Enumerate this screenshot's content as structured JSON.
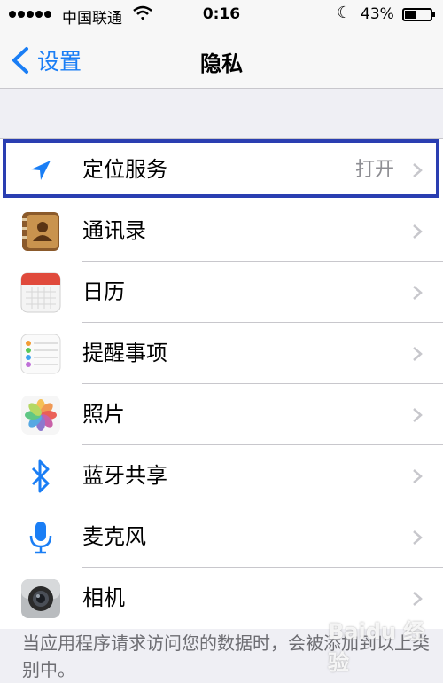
{
  "status_bar": {
    "carrier": "中国联通",
    "time": "0:16",
    "battery_percent": "43%",
    "battery_level": 0.43
  },
  "nav": {
    "back_label": "设置",
    "title": "隐私"
  },
  "rows": [
    {
      "label": "定位服务",
      "value": "打开",
      "icon": "location-arrow-icon"
    },
    {
      "label": "通讯录",
      "icon": "contacts-icon"
    },
    {
      "label": "日历",
      "icon": "calendar-icon"
    },
    {
      "label": "提醒事项",
      "icon": "reminders-icon"
    },
    {
      "label": "照片",
      "icon": "photos-icon"
    },
    {
      "label": "蓝牙共享",
      "icon": "bluetooth-icon"
    },
    {
      "label": "麦克风",
      "icon": "microphone-icon"
    },
    {
      "label": "相机",
      "icon": "camera-icon"
    }
  ],
  "footer_text": "当应用程序请求访问您的数据时，会被添加到以上类别中。",
  "watermark": "Baidu 经验",
  "colors": {
    "accent": "#1a7ef5",
    "highlight_border": "#2a3eb1",
    "secondary_text": "#8e8e93"
  }
}
